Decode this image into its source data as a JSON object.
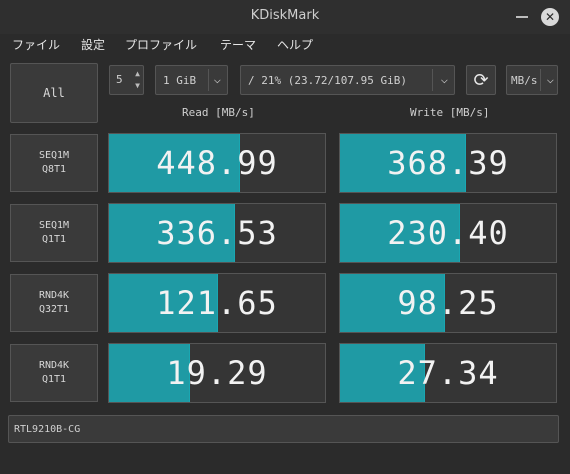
{
  "window": {
    "title": "KDiskMark"
  },
  "menu": [
    "ファイル",
    "設定",
    "プロファイル",
    "テーマ",
    "ヘルプ"
  ],
  "controls": {
    "all_button": "All",
    "runs": "5",
    "size": "1 GiB",
    "target": "/ 21% (23.72/107.95 GiB)",
    "unit": "MB/s"
  },
  "headers": {
    "read": "Read [MB/s]",
    "write": "Write [MB/s]"
  },
  "rows": [
    {
      "line1": "SEQ1M",
      "line2": "Q8T1",
      "read": "448.99",
      "write": "368.39",
      "read_fill": 0.6,
      "write_fill": 0.58
    },
    {
      "line1": "SEQ1M",
      "line2": "Q1T1",
      "read": "336.53",
      "write": "230.40",
      "read_fill": 0.58,
      "write_fill": 0.55
    },
    {
      "line1": "RND4K",
      "line2": "Q32T1",
      "read": "121.65",
      "write": "98.25",
      "read_fill": 0.5,
      "write_fill": 0.48
    },
    {
      "line1": "RND4K",
      "line2": "Q1T1",
      "read": "19.29",
      "write": "27.34",
      "read_fill": 0.37,
      "write_fill": 0.39
    }
  ],
  "device": "RTL9210B-CG",
  "colors": {
    "accent": "#1f9aa4",
    "background": "#2b2b2b"
  }
}
